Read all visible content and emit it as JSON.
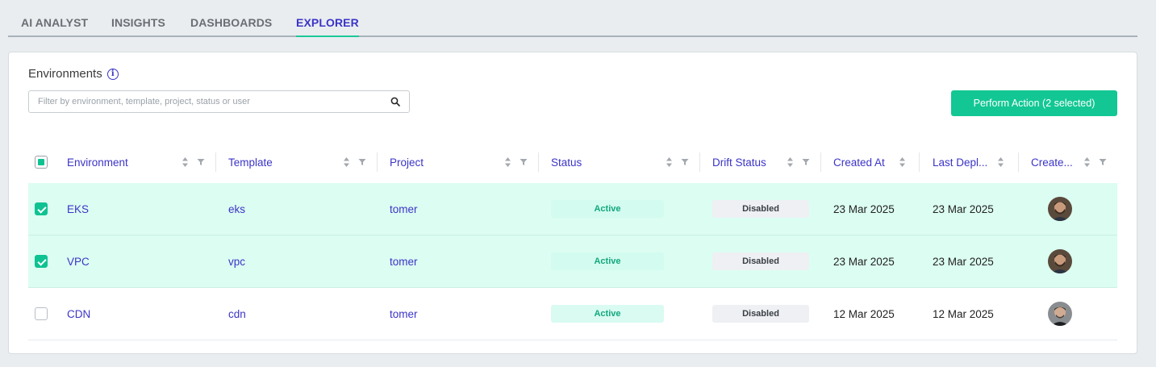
{
  "tabs": [
    {
      "label": "AI ANALYST",
      "active": false
    },
    {
      "label": "INSIGHTS",
      "active": false
    },
    {
      "label": "DASHBOARDS",
      "active": false
    },
    {
      "label": "EXPLORER",
      "active": true
    }
  ],
  "environments": {
    "title": "Environments",
    "info_icon": "info-icon",
    "search_placeholder": "Filter by environment, template, project, status or user",
    "search_value": "",
    "action_button": "Perform Action (2 selected)"
  },
  "table": {
    "select_all_state": "partial",
    "columns": [
      "Environment",
      "Template",
      "Project",
      "Status",
      "Drift Status",
      "Created At",
      "Last Depl...",
      "Create..."
    ],
    "rows": [
      {
        "selected": true,
        "environment": "EKS",
        "template": "eks",
        "project": "tomer",
        "status": "Active",
        "drift_status": "Disabled",
        "created_at": "23 Mar 2025",
        "last_deployed": "23 Mar 2025",
        "avatar": "user-avatar-bearded"
      },
      {
        "selected": true,
        "environment": "VPC",
        "template": "vpc",
        "project": "tomer",
        "status": "Active",
        "drift_status": "Disabled",
        "created_at": "23 Mar 2025",
        "last_deployed": "23 Mar 2025",
        "avatar": "user-avatar-bearded"
      },
      {
        "selected": false,
        "environment": "CDN",
        "template": "cdn",
        "project": "tomer",
        "status": "Active",
        "drift_status": "Disabled",
        "created_at": "12 Mar 2025",
        "last_deployed": "12 Mar 2025",
        "avatar": "user-avatar-grey"
      }
    ]
  },
  "colors": {
    "accent": "#3b34c7",
    "primary_button": "#12c794",
    "selected_row": "#dcfdf2",
    "active_text": "#12a87d"
  }
}
